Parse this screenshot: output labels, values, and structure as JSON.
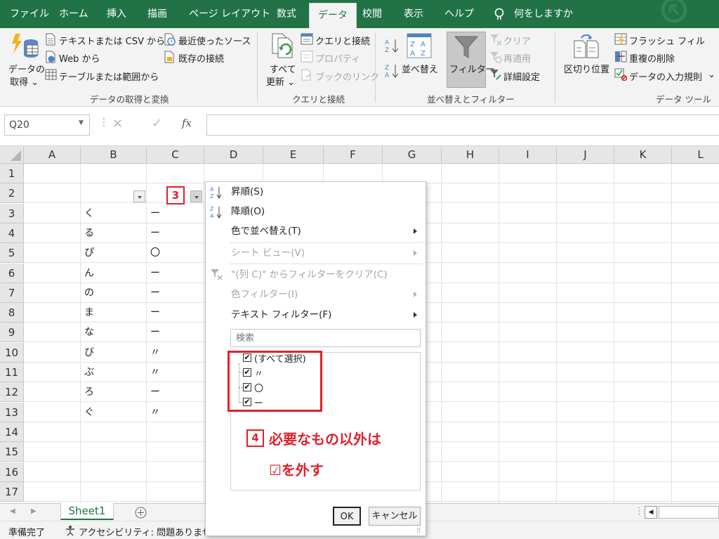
{
  "tabs": [
    {
      "label": "ファイル",
      "active": false
    },
    {
      "label": "ホーム",
      "active": false
    },
    {
      "label": "挿入",
      "active": false
    },
    {
      "label": "描画",
      "active": false
    },
    {
      "label": "ページ レイアウト",
      "active": false
    },
    {
      "label": "数式",
      "active": false
    },
    {
      "label": "データ",
      "active": true
    },
    {
      "label": "校閲",
      "active": false
    },
    {
      "label": "表示",
      "active": false
    },
    {
      "label": "ヘルプ",
      "active": false
    }
  ],
  "tell_me": "何をしますか",
  "ribbon": {
    "get_data": {
      "line1": "データの",
      "line2": "取得 ⌄"
    },
    "text_csv": "テキストまたは CSV から",
    "web": "Web から",
    "table_range": "テーブルまたは範囲から",
    "recent_sources": "最近使ったソース",
    "existing_conn": "既存の接続",
    "group_get": "データの取得と変換",
    "refresh_all": {
      "line1": "すべて",
      "line2": "更新 ⌄"
    },
    "queries_conn": "クエリと接続",
    "properties": "プロパティ",
    "edit_links": "ブックのリンク",
    "group_queries": "クエリと接続",
    "sort_btn": "並べ替え",
    "filter_btn": "フィルター",
    "clear": "クリア",
    "reapply": "再適用",
    "advanced": "詳細設定",
    "group_sort": "並べ替えとフィルター",
    "text_to_columns": "区切り位置",
    "flash_fill": "フラッシュ フィル",
    "remove_dup": "重複の削除",
    "validation": "データの入力規則",
    "group_tools": "データ ツール"
  },
  "formula_bar": {
    "name_box": "Q20",
    "fx": "fx",
    "formula": ""
  },
  "columns": [
    "A",
    "B",
    "C",
    "D",
    "E",
    "F",
    "G",
    "H",
    "I",
    "J",
    "K",
    "L"
  ],
  "rows": [
    "1",
    "2",
    "3",
    "4",
    "5",
    "6",
    "7",
    "8",
    "9",
    "10",
    "11",
    "12",
    "13",
    "14",
    "15",
    "16",
    "17"
  ],
  "cells_b": [
    "く",
    "る",
    "ぴ",
    "ん",
    "の",
    "ま",
    "な",
    "び",
    "ぶ",
    "ろ",
    "ぐ"
  ],
  "cells_c": [
    "ー",
    "ー",
    "〇",
    "ー",
    "ー",
    "ー",
    "ー",
    "〃",
    "〃",
    "ー",
    "〃"
  ],
  "step3": "3",
  "filter_menu": {
    "sort_asc": "昇順(S)",
    "sort_desc": "降順(O)",
    "sort_color": "色で並べ替え(T)",
    "sheet_view": "シート ビュー(V)",
    "clear_filter": "\"(列 C)\" からフィルターをクリア(C)",
    "color_filter": "色フィルター(I)",
    "text_filter": "テキスト フィルター(F)",
    "search_placeholder": "検索",
    "items": [
      "(すべて選択)",
      "〃",
      "〇",
      "ー"
    ],
    "ok": "OK",
    "cancel": "キャンセル"
  },
  "annotation": {
    "step4": "4",
    "line1": "必要なもの以外は",
    "line2": "☑を外す",
    "color": "#e0202a"
  },
  "sheet_tab": "Sheet1",
  "status": {
    "ready": "準備完了",
    "accessibility": "アクセシビリティ: 問題ありません"
  }
}
